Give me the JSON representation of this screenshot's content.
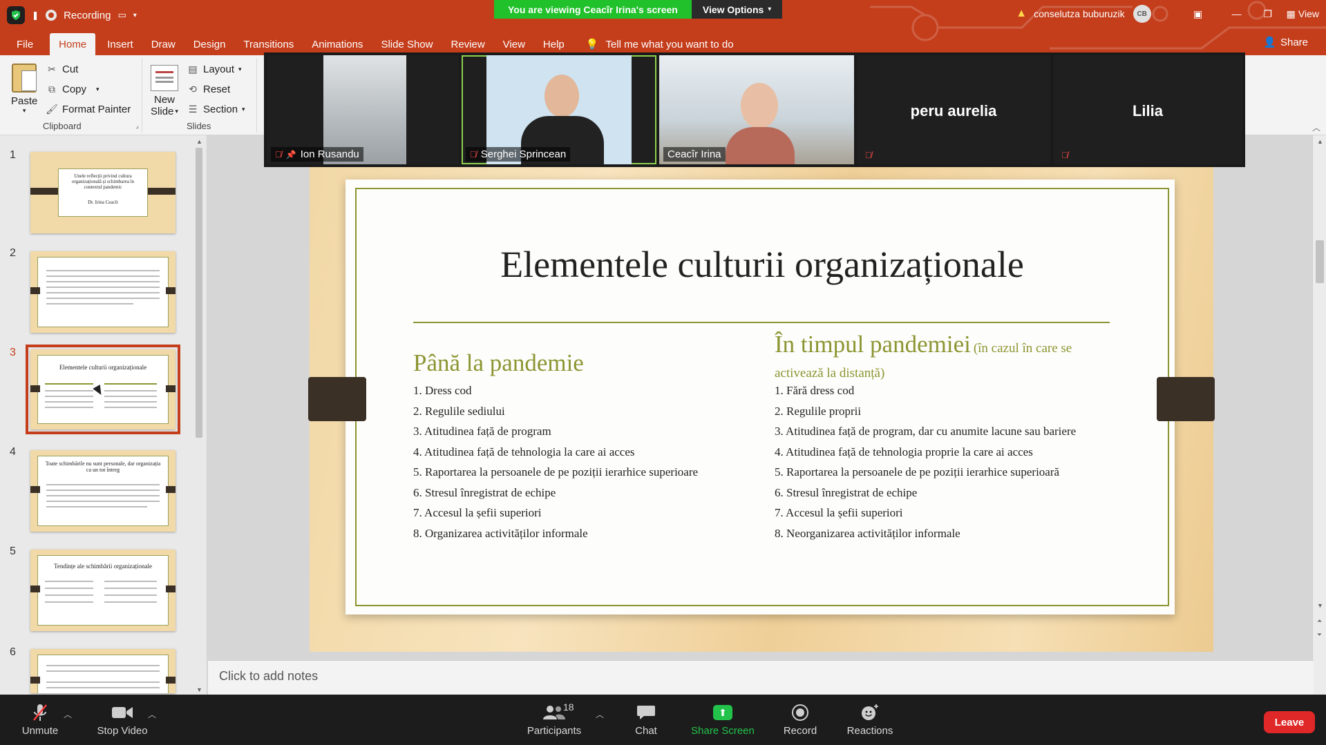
{
  "window": {
    "recording_label": "Recording",
    "banner_viewing": "You are viewing Ceacîr Irina's screen",
    "banner_view_options": "View Options",
    "user_name": "conselutza buburuzik",
    "user_initials": "CB",
    "view_label": "View"
  },
  "ribbon_tabs": [
    "File",
    "Home",
    "Insert",
    "Draw",
    "Design",
    "Transitions",
    "Animations",
    "Slide Show",
    "Review",
    "View",
    "Help"
  ],
  "tell_me": "Tell me what you want to do",
  "share_label": "Share",
  "clipboard": {
    "paste": "Paste",
    "cut": "Cut",
    "copy": "Copy",
    "format_painter": "Format Painter",
    "group_label": "Clipboard"
  },
  "slides_group": {
    "new_slide_line1": "New",
    "new_slide_line2": "Slide",
    "layout": "Layout",
    "reset": "Reset",
    "section": "Section",
    "group_label": "Slides"
  },
  "participants_video": [
    {
      "name": "Ion Rusandu"
    },
    {
      "name": "Serghei Sprincean"
    },
    {
      "name": "Ceacîr Irina"
    },
    {
      "name": "peru aurelia"
    },
    {
      "name": "Lilia"
    }
  ],
  "thumbnails": [
    {
      "number": "1",
      "title": "Unele reflecții privind cultura organizațională și schimbarea în contextul pandemic",
      "subtitle": "Dr. Irina Ceacîr"
    },
    {
      "number": "2",
      "title": ""
    },
    {
      "number": "3",
      "title": "Elementele culturii organizaționale"
    },
    {
      "number": "4",
      "title": "Toate schimbările nu sunt personale, dar organizația ca un tot întreg"
    },
    {
      "number": "5",
      "title": "Tendințe ale schimbării organizaționale"
    },
    {
      "number": "6",
      "title": ""
    }
  ],
  "slide": {
    "title": "Elementele culturii organizaționale",
    "left_heading": "Până la pandemie",
    "right_heading": "În timpul pandemiei",
    "right_heading_note_1": "(în cazul în care se",
    "right_heading_note_2": "activează la distanță)",
    "left_items": [
      "1. Dress cod",
      "2. Regulile sediului",
      "3. Atitudinea față de program",
      "4. Atitudinea față de tehnologia la care ai acces",
      "5. Raportarea la persoanele de pe poziții ierarhice superioare",
      "6. Stresul înregistrat de echipe",
      "7. Accesul la șefii superiori",
      "8. Organizarea activităților informale"
    ],
    "right_items": [
      "1. Fără dress cod",
      "2. Regulile proprii",
      "3. Atitudinea față de program, dar cu anumite lacune sau bariere",
      "4. Atitudinea față de tehnologia proprie la care ai acces",
      "5. Raportarea la persoanele de pe poziții ierarhice superioară",
      "6. Stresul înregistrat de echipe",
      "7. Accesul la șefii superiori",
      "8. Neorganizarea activităților informale"
    ]
  },
  "notes_placeholder": "Click to add notes",
  "zoom_toolbar": {
    "unmute": "Unmute",
    "stop_video": "Stop Video",
    "participants": "Participants",
    "participants_count": "18",
    "chat": "Chat",
    "share_screen": "Share Screen",
    "record": "Record",
    "reactions": "Reactions",
    "leave": "Leave"
  },
  "colors": {
    "ppt_red": "#c43e1c",
    "olive_accent": "#8c9531",
    "zoom_green": "#21c12b",
    "leave_red": "#e02828"
  }
}
